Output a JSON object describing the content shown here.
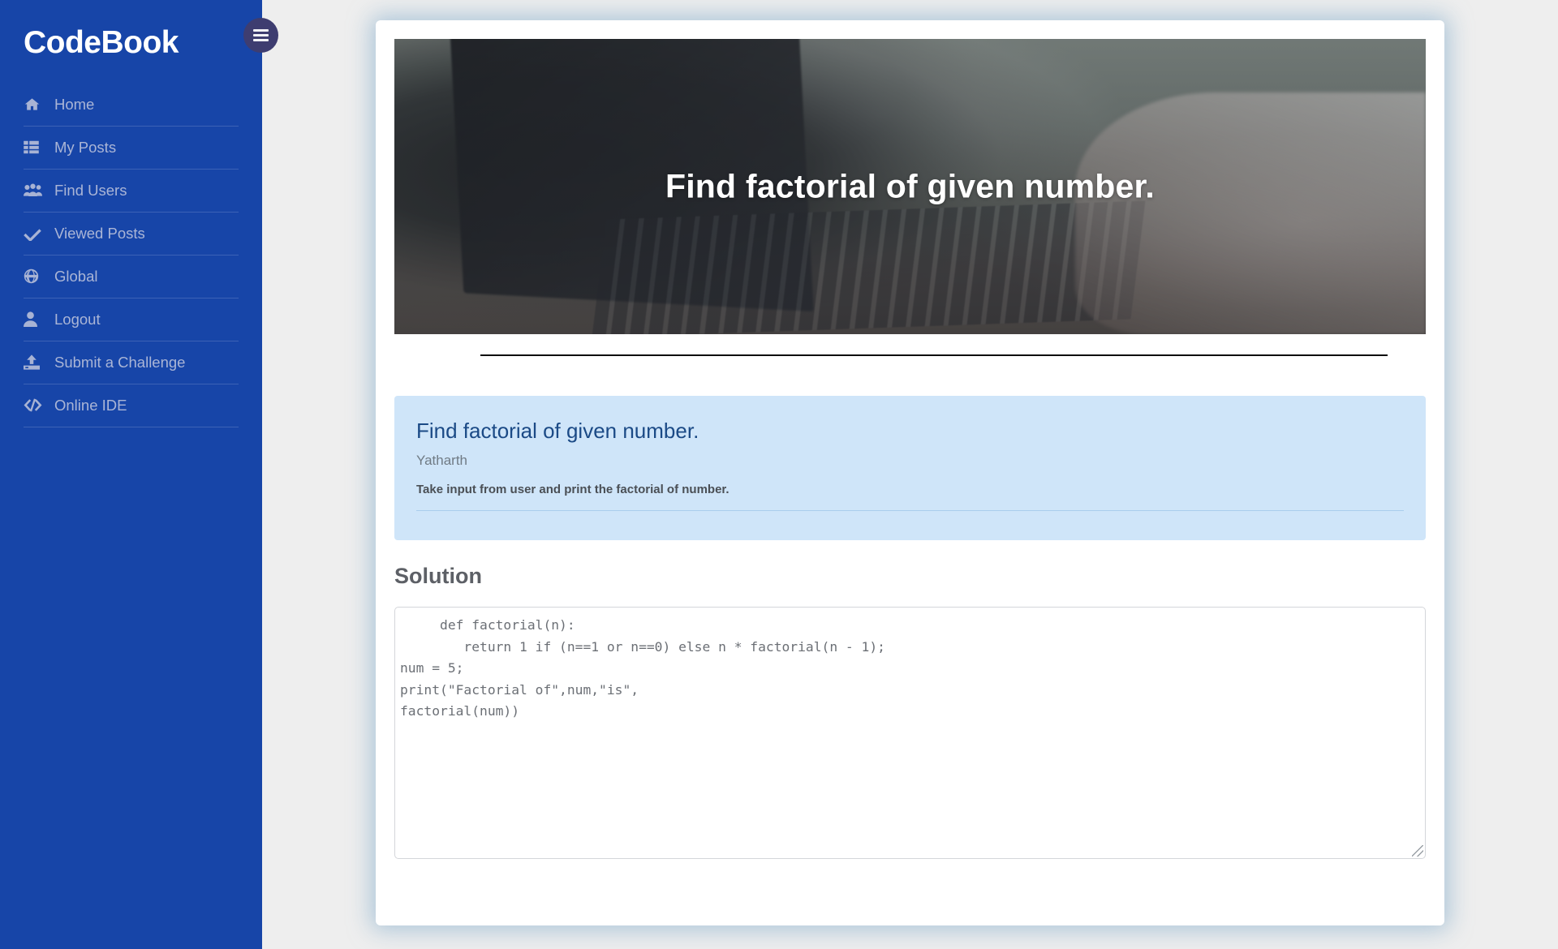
{
  "sidebar": {
    "brand": "CodeBook",
    "menu_button": "menu-toggle",
    "items": [
      {
        "label": "Home",
        "icon": "home-icon"
      },
      {
        "label": "My Posts",
        "icon": "list-icon"
      },
      {
        "label": "Find Users",
        "icon": "users-icon"
      },
      {
        "label": "Viewed Posts",
        "icon": "check-icon"
      },
      {
        "label": "Global",
        "icon": "globe-icon"
      },
      {
        "label": "Logout",
        "icon": "user-icon"
      },
      {
        "label": "Submit a Challenge",
        "icon": "upload-icon"
      },
      {
        "label": "Online IDE",
        "icon": "code-icon"
      }
    ]
  },
  "hero": {
    "title": "Find factorial of given number.",
    "image_alt": "laptop-desk-photo"
  },
  "post": {
    "title": "Find factorial of given number.",
    "author": "Yatharth",
    "description": "Take input from user and print the factorial of number."
  },
  "solution": {
    "heading": "Solution",
    "code": "     def factorial(n):\n        return 1 if (n==1 or n==0) else n * factorial(n - 1);\nnum = 5;\nprint(\"Factorial of\",num,\"is\",\nfactorial(num))"
  },
  "colors": {
    "sidebar_bg": "#1745a8",
    "sidebar_text": "#aab5d6",
    "hamburger_bg": "#3e3d70",
    "page_bg": "#eeeeee",
    "card_bg": "#ffffff",
    "info_card_bg": "#cfe5f9",
    "info_title": "#1b4a86",
    "heading_gray": "#5d6066",
    "code_text": "#6b6f75"
  }
}
